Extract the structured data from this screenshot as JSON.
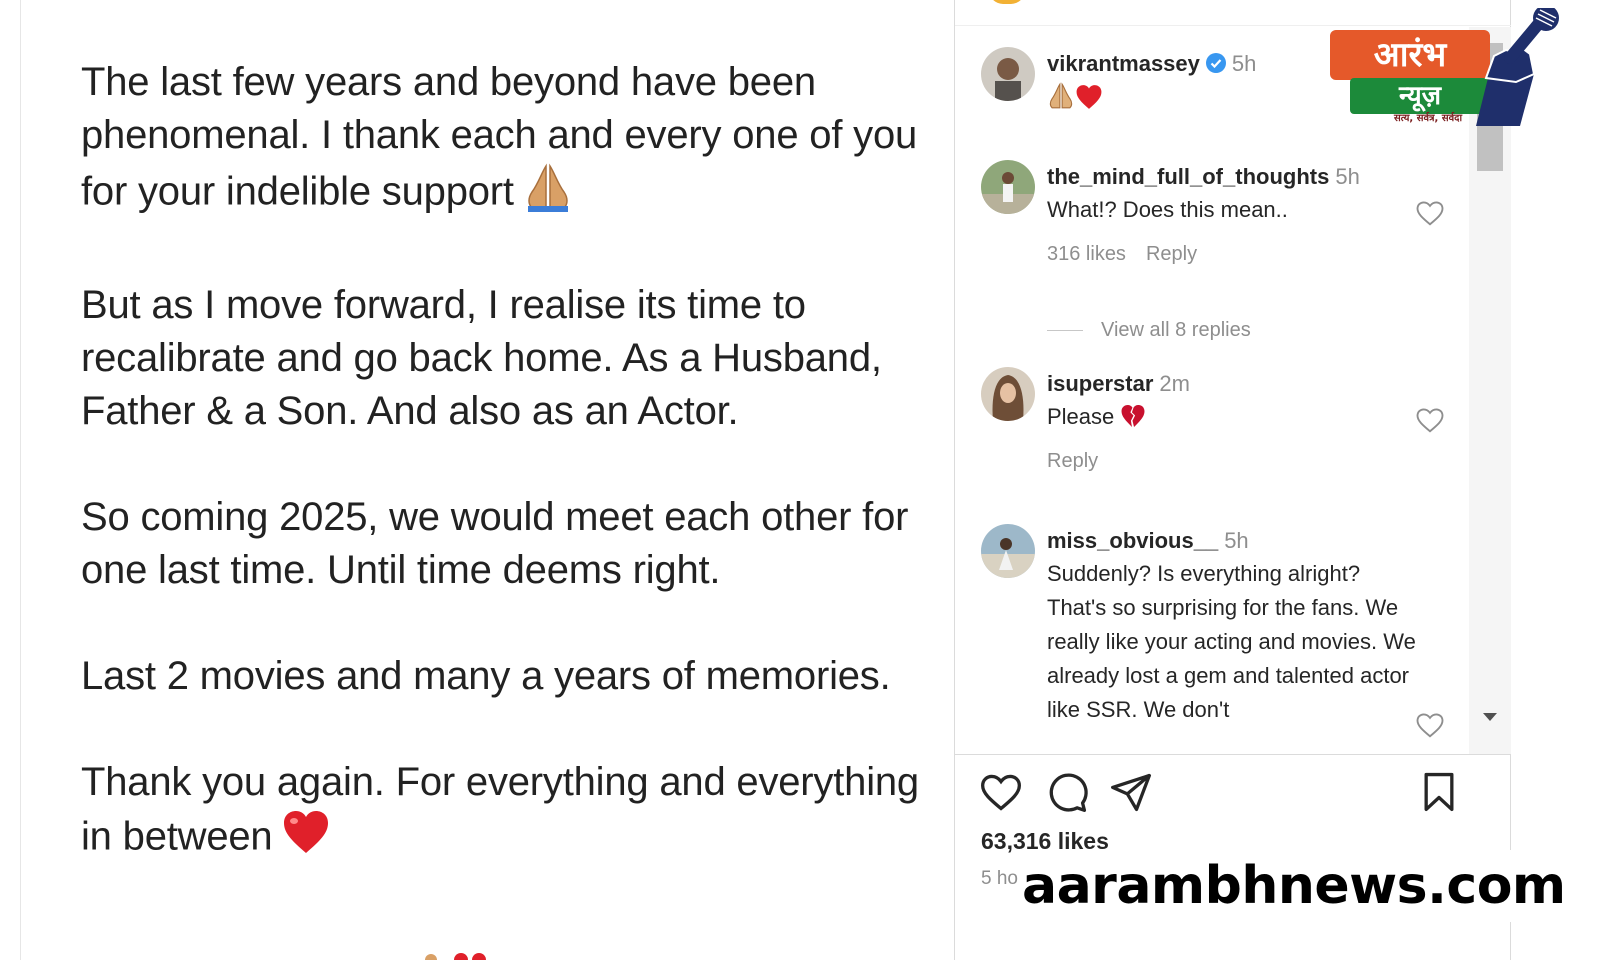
{
  "post": {
    "paragraphs": [
      "The last few years and beyond have been phenomenal. I thank each and every one of you for your indelible support",
      "But as I move forward, I realise its time to recalibrate and go back home. As a Husband, Father & a Son. And also as an Actor.",
      "So coming 2025, we would meet each other for one last time. Until time deems right.",
      "Last 2 movies and many a years of memories.",
      "Thank you again. For everything and everything in between"
    ],
    "emoji_icons": [
      "folded-hands-icon",
      "red-heart-icon"
    ]
  },
  "comments": [
    {
      "username": "vikrantmassey",
      "verified": true,
      "time": "5h",
      "text": "",
      "emoji_icons": [
        "folded-hands-icon",
        "red-heart-icon"
      ]
    },
    {
      "username": "the_mind_full_of_thoughts",
      "time": "5h",
      "text": "What!? Does this mean..",
      "likes": "316 likes",
      "reply": "Reply"
    },
    {
      "username": "isuperstar",
      "time": "2m",
      "text": "Please",
      "emoji_icons": [
        "broken-heart-icon"
      ],
      "reply": "Reply"
    },
    {
      "username": "miss_obvious__",
      "time": "5h",
      "text": "Suddenly? Is everything alright? That's so surprising for the fans. We really like your acting and movies. We already lost a gem and talented actor like SSR. We don't"
    }
  ],
  "view_replies": "View all 8 replies",
  "likes_count": "63,316 likes",
  "time_ago": "5 ho",
  "watermark": "aarambhnews.com",
  "logo": {
    "top": "आरंभ",
    "middle": "न्यूज़",
    "tagline": "सत्य, सर्वत्र, सर्वदा"
  },
  "colors": {
    "verified": "#3897f0",
    "heart": "#e0202a",
    "logo_orange": "#e5592a",
    "logo_green": "#1c8a3a",
    "logo_navy": "#1f2f6b"
  }
}
